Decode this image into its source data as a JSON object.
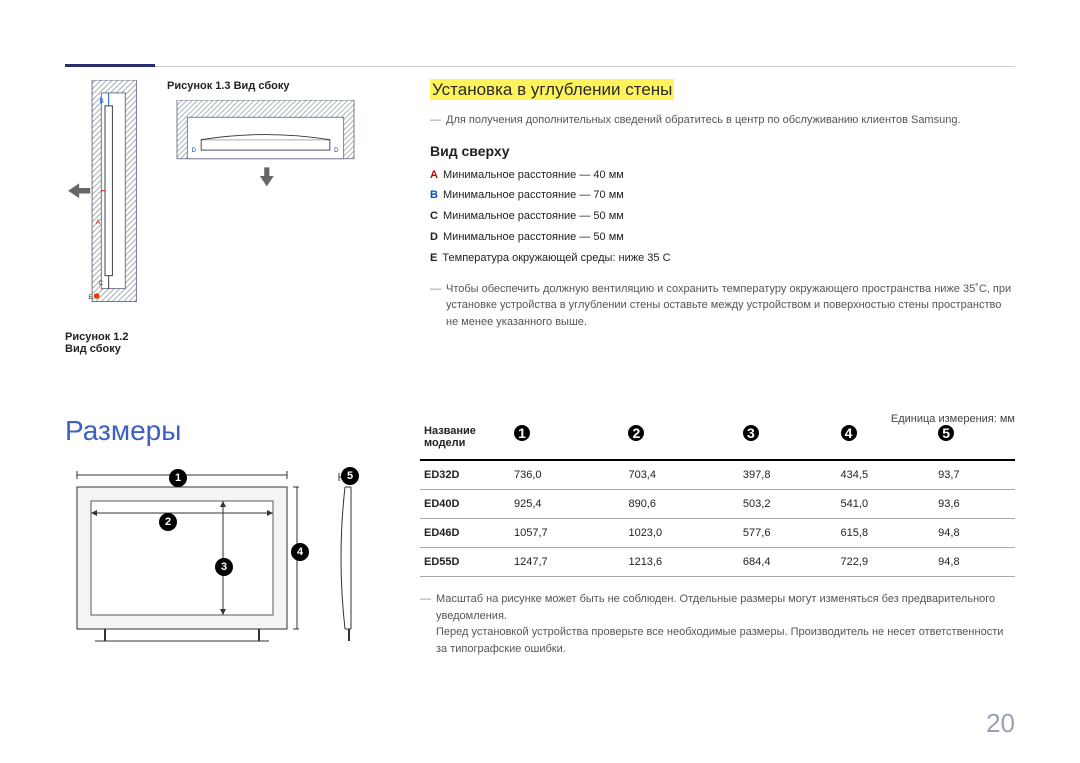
{
  "figures": {
    "fig13_label": "Рисунок 1.3 Вид сбоку",
    "fig12_label": "Рисунок 1.2 Вид сбоку",
    "side_letters": {
      "B": "B",
      "A": "A",
      "C": "C",
      "E": "E"
    },
    "top_letters": {
      "D_left": "D",
      "D_right": "D"
    }
  },
  "install": {
    "heading": "Установка в углублении стены",
    "note": "Для получения дополнительных сведений обратитесь в центр по обслуживанию клиентов Samsung.",
    "sub": "Вид сверху",
    "specs": [
      {
        "key": "A",
        "text": "Минимальное расстояние — 40 мм",
        "color": "#c00"
      },
      {
        "key": "B",
        "text": "Минимальное расстояние — 70 мм",
        "color": "#0050c8"
      },
      {
        "key": "C",
        "text": "Минимальное расстояние — 50 мм",
        "color": "#444"
      },
      {
        "key": "D",
        "text": "Минимальное расстояние — 50 мм",
        "color": "#444"
      },
      {
        "key": "E",
        "text": "Температура окружающей среды: ниже 35 C",
        "color": "#444",
        "deg": "˚"
      }
    ],
    "warn": "Чтобы обеспечить должную вентиляцию и сохранить температуру окружающего пространства ниже 35˚C, при установке устройства в углублении стены оставьте между устройством и поверхностью стены пространство не менее указанного выше."
  },
  "dimensions": {
    "heading": "Размеры",
    "unit": "Единица измерения: мм",
    "col0": "Название модели",
    "cols": [
      "1",
      "2",
      "3",
      "4",
      "5"
    ],
    "rows": [
      {
        "name": "ED32D",
        "v": [
          "736,0",
          "703,4",
          "397,8",
          "434,5",
          "93,7"
        ]
      },
      {
        "name": "ED40D",
        "v": [
          "925,4",
          "890,6",
          "503,2",
          "541,0",
          "93,6"
        ]
      },
      {
        "name": "ED46D",
        "v": [
          "1057,7",
          "1023,0",
          "577,6",
          "615,8",
          "94,8"
        ]
      },
      {
        "name": "ED55D",
        "v": [
          "1247,7",
          "1213,6",
          "684,4",
          "722,9",
          "94,8"
        ]
      }
    ],
    "note1": "Масштаб на рисунке может быть не соблюден. Отдельные размеры могут изменяться без предварительного уведомления.",
    "note2": "Перед установкой устройства проверьте все необходимые размеры. Производитель не несет ответственности за типографские ошибки."
  },
  "page_number": "20"
}
